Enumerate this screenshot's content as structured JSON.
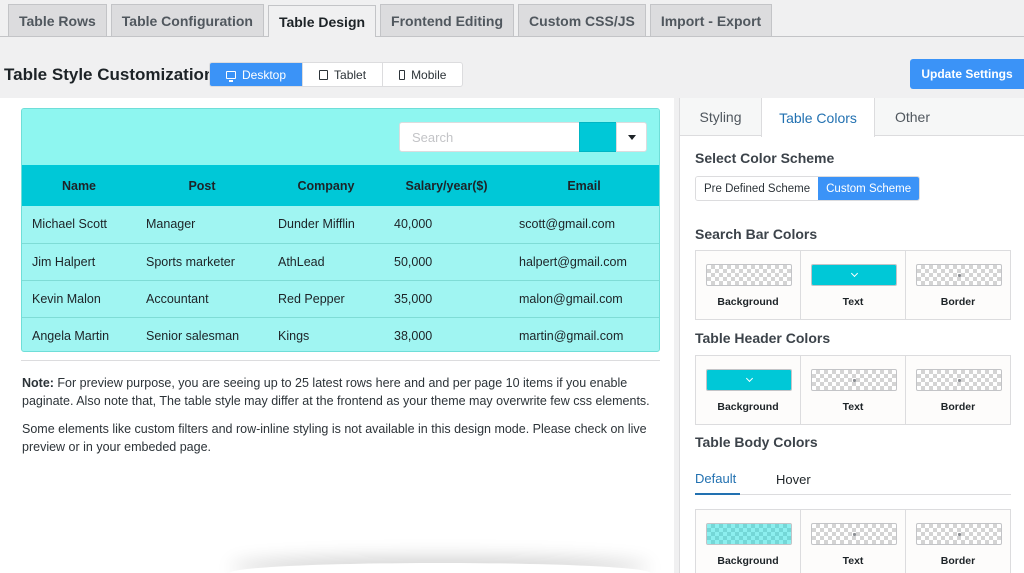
{
  "top_tabs": [
    {
      "label": "Table Rows"
    },
    {
      "label": "Table Configuration"
    },
    {
      "label": "Table Design"
    },
    {
      "label": "Frontend Editing"
    },
    {
      "label": "Custom CSS/JS"
    },
    {
      "label": "Import - Export"
    }
  ],
  "active_top_tab": "Table Design",
  "page_title": "Table Style Customization",
  "devices": [
    {
      "label": "Desktop",
      "icon": "monitor-icon"
    },
    {
      "label": "Tablet",
      "icon": "tablet-icon"
    },
    {
      "label": "Mobile",
      "icon": "phone-icon"
    }
  ],
  "update_button": "Update Settings",
  "preview": {
    "search_placeholder": "Search",
    "columns": [
      "Name",
      "Post",
      "Company",
      "Salary/year($)",
      "Email"
    ],
    "rows": [
      [
        "Michael Scott",
        "Manager",
        "Dunder Mifflin",
        "40,000",
        "scott@gmail.com"
      ],
      [
        "Jim Halpert",
        "Sports marketer",
        "AthLead",
        "50,000",
        "halpert@gmail.com"
      ],
      [
        "Kevin Malon",
        "Accountant",
        "Red Pepper",
        "35,000",
        "malon@gmail.com"
      ],
      [
        "Angela Martin",
        "Senior salesman",
        "Kings",
        "38,000",
        "martin@gmail.com"
      ]
    ],
    "note_label": "Note:",
    "note_text": " For preview purpose, you are seeing up to 25 latest rows here and and per page 10 items if you enable paginate. Also note that, The table style may differ at the frontend as your theme may overwrite few css elements.",
    "note2_text": "Some elements like custom filters and row-inline styling is not available in this design mode. Please check on live preview or in your embeded page."
  },
  "panel": {
    "tabs": [
      "Styling",
      "Table Colors",
      "Other"
    ],
    "active_tab": "Table Colors",
    "select_scheme_heading": "Select Color Scheme",
    "scheme_options": [
      "Pre Defined Scheme",
      "Custom Scheme"
    ],
    "active_scheme": "Custom Scheme",
    "search_bar_heading": "Search Bar Colors",
    "table_header_heading": "Table Header Colors",
    "table_body_heading": "Table Body Colors",
    "body_tabs": [
      "Default",
      "Hover"
    ],
    "cell_labels": [
      "Background",
      "Text",
      "Border"
    ]
  },
  "colors": {
    "accent": "#3b93f7",
    "header_bg": "#00c8d7",
    "body_bg": "#a0f5f2",
    "search_button": "#00c8d7"
  }
}
